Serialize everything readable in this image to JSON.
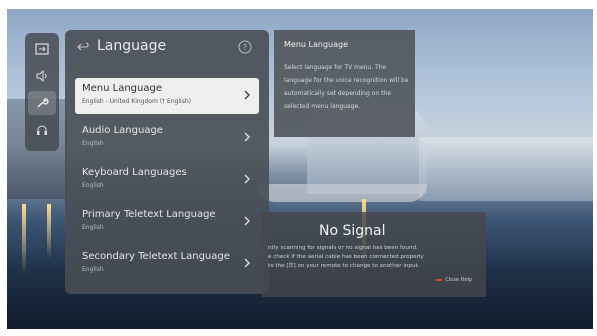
{
  "sidebar": {
    "icons": [
      "input-icon",
      "sound-icon",
      "general-icon",
      "support-icon"
    ],
    "active_index": 2
  },
  "panel": {
    "title": "Language",
    "items": [
      {
        "label": "Menu Language",
        "value": "English - United Kingdom († English)",
        "selected": true
      },
      {
        "label": "Audio Language",
        "value": "English",
        "selected": false
      },
      {
        "label": "Keyboard Languages",
        "value": "English",
        "selected": false
      },
      {
        "label": "Primary Teletext Language",
        "value": "English",
        "selected": false
      },
      {
        "label": "Secondary Teletext Language",
        "value": "English",
        "selected": false
      }
    ]
  },
  "tooltip": {
    "title": "Menu Language",
    "body": "Select language for TV menu. The language for the voice recognition will be automatically set depending on the selected menu language."
  },
  "no_signal": {
    "title": "No Signal",
    "line1": "ntly scanning for signals or no signal has been found.",
    "line2": "e check if the aerial cable has been connected properly",
    "line3": "to the [☰] on your remote to change to another input.",
    "hint": "Close Help"
  },
  "colors": {
    "accent": "#e0433c"
  }
}
